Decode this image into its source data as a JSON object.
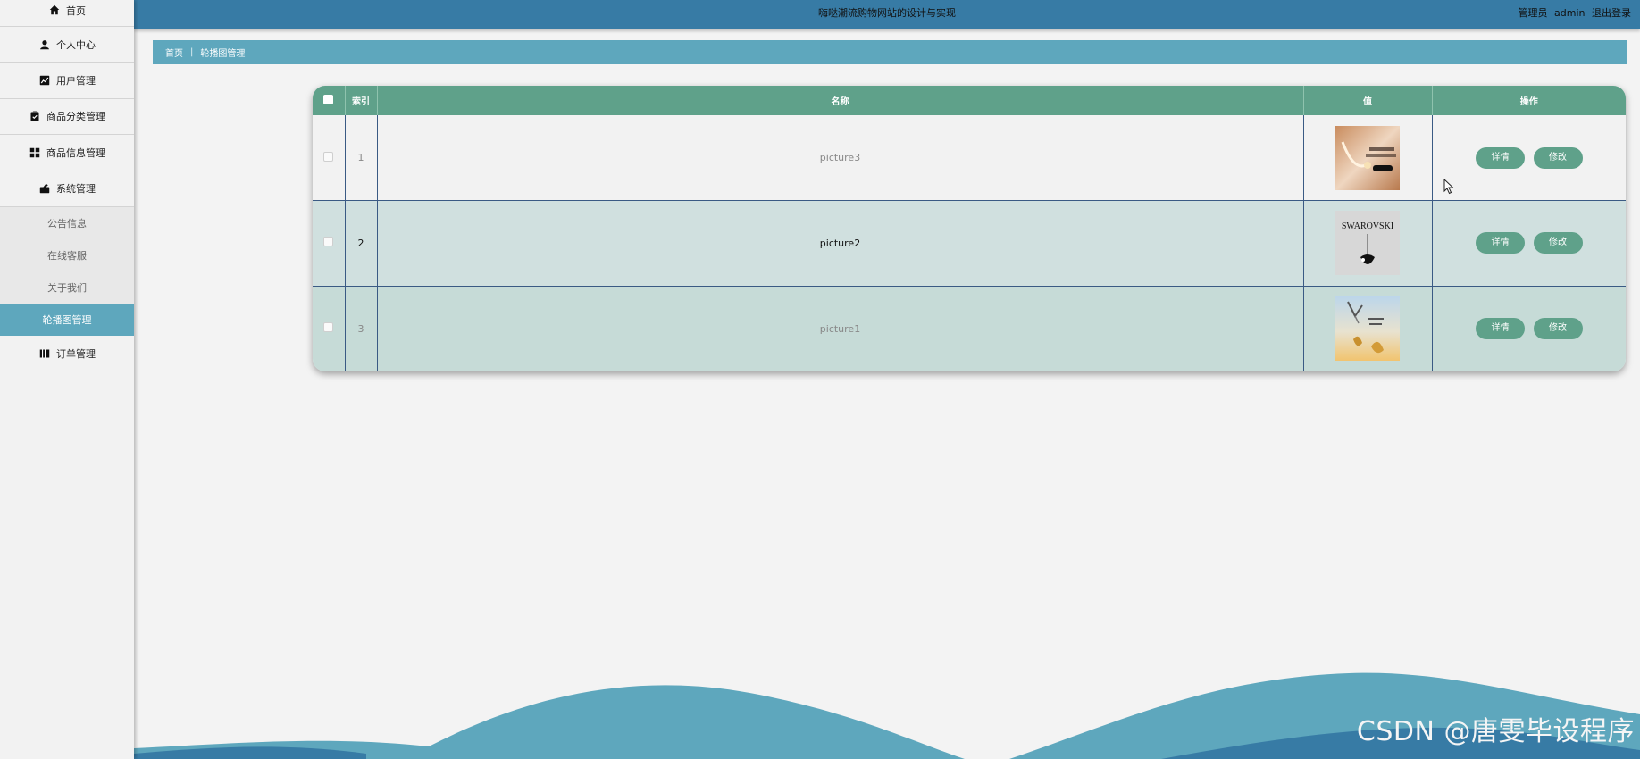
{
  "header": {
    "title": "嗨哒潮流购物网站的设计与实现",
    "user_role": "管理员",
    "username": "admin",
    "logout": "退出登录"
  },
  "sidebar": {
    "items": [
      {
        "label": "首页",
        "icon": "home-icon"
      },
      {
        "label": "个人中心",
        "icon": "user-icon"
      },
      {
        "label": "用户管理",
        "icon": "chart-icon"
      },
      {
        "label": "商品分类管理",
        "icon": "clipboard-icon"
      },
      {
        "label": "商品信息管理",
        "icon": "grid-icon"
      },
      {
        "label": "系统管理",
        "icon": "settings-icon"
      }
    ],
    "submenu": [
      {
        "label": "公告信息"
      },
      {
        "label": "在线客服"
      },
      {
        "label": "关于我们"
      },
      {
        "label": "轮播图管理"
      }
    ],
    "last_item": {
      "label": "订单管理",
      "icon": "book-icon"
    }
  },
  "breadcrumb": {
    "home": "首页",
    "separator": "|",
    "current": "轮播图管理"
  },
  "table": {
    "columns": [
      "",
      "索引",
      "名称",
      "值",
      "操作"
    ],
    "rows": [
      {
        "index": "1",
        "name": "picture3",
        "image": "gold-necklace-thumbnail"
      },
      {
        "index": "2",
        "name": "picture2",
        "image": "swarovski-thumbnail",
        "logo_text": "SWAROVSKI"
      },
      {
        "index": "3",
        "name": "picture1",
        "image": "gold-earrings-thumbnail"
      }
    ],
    "detail_label": "详情",
    "edit_label": "修改"
  },
  "watermark": "CSDN @唐雯毕设程序",
  "colors": {
    "header": "#377ba5",
    "breadcrumb": "#5ea7bd",
    "table_header": "#5fa18a",
    "button": "#5fa18a",
    "active_menu": "#5ea7bd"
  }
}
